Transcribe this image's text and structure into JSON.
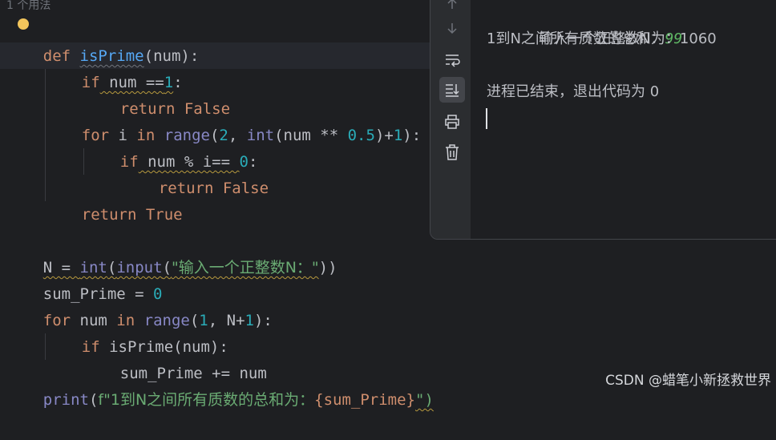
{
  "editor": {
    "usage_hint": "1 个用法",
    "lines": [
      {
        "parts": [
          "def",
          " ",
          "isPrime",
          "(num):"
        ]
      },
      {
        "parts": [
          "if",
          " num ==",
          "1",
          ":"
        ]
      },
      {
        "parts": [
          "return",
          " ",
          "False"
        ]
      },
      {
        "parts": [
          "for",
          " i ",
          "in",
          " ",
          "range",
          "(",
          "2",
          ", ",
          "int",
          "(num ** ",
          "0.5",
          ")+",
          "1",
          "):"
        ]
      },
      {
        "parts": [
          "if",
          " num % i== ",
          "0",
          ":"
        ]
      },
      {
        "parts": [
          "return",
          " ",
          "False"
        ]
      },
      {
        "parts": [
          "return",
          " ",
          "True"
        ]
      },
      {
        "parts": [
          "N = ",
          "int",
          "(",
          "input",
          "(",
          "\"输入一个正整数N：\"",
          "))"
        ]
      },
      {
        "parts": [
          "sum_Prime = ",
          "0"
        ]
      },
      {
        "parts": [
          "for",
          " num ",
          "in",
          " ",
          "range",
          "(",
          "1",
          ", N+",
          "1",
          "):"
        ]
      },
      {
        "parts": [
          "if",
          " isPrime(num):"
        ]
      },
      {
        "parts": [
          "sum_Prime += num"
        ]
      },
      {
        "parts": [
          "print",
          "(",
          "f\"1到N之间所有质数的总和为：",
          "{sum_Prime}",
          "\")"
        ]
      }
    ]
  },
  "console": {
    "prompt": "输入一个正整数N：",
    "user_input": "99",
    "result": "1到N之间所有质数的总和为：1060",
    "exit_message": "进程已结束，退出代码为 0"
  },
  "toolbar_icons": [
    "arrow-down-icon",
    "soft-wrap-icon",
    "scroll-to-end-icon",
    "print-icon",
    "trash-icon"
  ],
  "watermark": "CSDN @蜡笔小新拯救世界",
  "colors": {
    "background": "#1e1f22",
    "keyword": "#cf8e6d",
    "function": "#56a8f5",
    "builtin": "#8888c6",
    "number": "#2aacb8",
    "string": "#6aab73",
    "user_input": "#5fb865"
  }
}
